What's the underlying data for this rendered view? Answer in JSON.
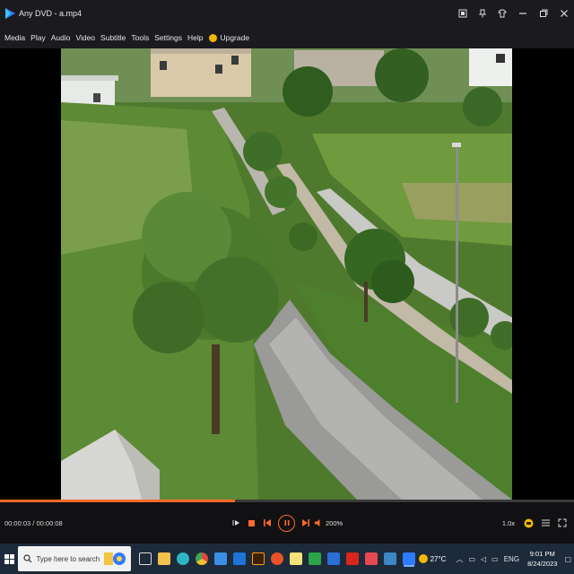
{
  "window": {
    "title": "Any DVD - a.mp4"
  },
  "menu": {
    "items": [
      "Media",
      "Play",
      "Audio",
      "Video",
      "Subtitle",
      "Tools",
      "Settings",
      "Help"
    ],
    "upgrade_label": "Upgrade"
  },
  "player": {
    "current_time": "00:00:03",
    "duration": "00:00:08",
    "time_separator": "/",
    "progress": 0.41,
    "volume": "200%",
    "speed": "1.0x",
    "accent_color": "#ff6a2a"
  },
  "taskbar": {
    "search_placeholder": "Type here to search",
    "weather_temp": "27°C",
    "language": "ENG",
    "time": "9:01 PM",
    "date": "8/24/2023"
  },
  "colors": {
    "titlebar_bg": "#1b1b1f",
    "taskbar_bg": "#1d2a3a",
    "progress_fill": "#ff6a2a"
  }
}
